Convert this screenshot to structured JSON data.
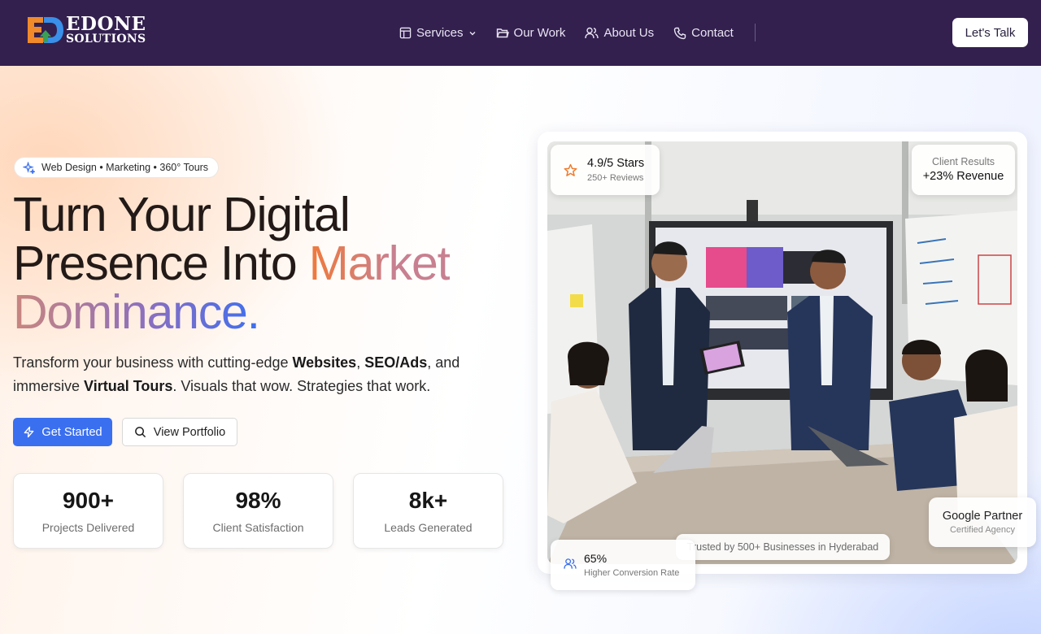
{
  "brand": {
    "line1": "EDONE",
    "line2": "SOLUTIONS",
    "mark": "ED"
  },
  "nav": {
    "items": [
      {
        "label": "Services",
        "icon": "layout-icon",
        "dropdown": true
      },
      {
        "label": "Our Work",
        "icon": "folder-icon"
      },
      {
        "label": "About Us",
        "icon": "users-icon"
      },
      {
        "label": "Contact",
        "icon": "phone-icon"
      }
    ],
    "cta": "Let's Talk"
  },
  "hero": {
    "pill": "Web Design • Marketing • 360° Tours",
    "headline": {
      "part1": "Turn Your Digital",
      "part2": "Presence Into ",
      "highlight1": "Market",
      "highlight2": "Dominance."
    },
    "subtitle": {
      "s1": "Transform your business with cutting-edge ",
      "b1": "Websites",
      "s2": ", ",
      "b2": "SEO/Ads",
      "s3": ", and immersive ",
      "b3": "Virtual Tours",
      "s4": ". Visuals that wow. Strategies that work."
    },
    "primary_button": "Get Started",
    "secondary_button": "View Portfolio",
    "stats": [
      {
        "value": "900+",
        "label": "Projects Delivered"
      },
      {
        "value": "98%",
        "label": "Client Satisfaction"
      },
      {
        "value": "8k+",
        "label": "Leads Generated"
      }
    ]
  },
  "showcase": {
    "rating": {
      "title": "4.9/5 Stars",
      "sub": "250+ Reviews"
    },
    "results": {
      "title": "Client Results",
      "value": "+23% Revenue"
    },
    "partner": {
      "title": "Google Partner",
      "sub": "Certified Agency"
    },
    "trusted": "Trusted by 500+ Businesses in Hyderabad",
    "conversion": {
      "value": "65%",
      "label": "Higher Conversion Rate"
    }
  },
  "colors": {
    "nav_bg": "#33204f",
    "primary": "#3a6ff0",
    "accent_orange": "#f07a3a"
  }
}
